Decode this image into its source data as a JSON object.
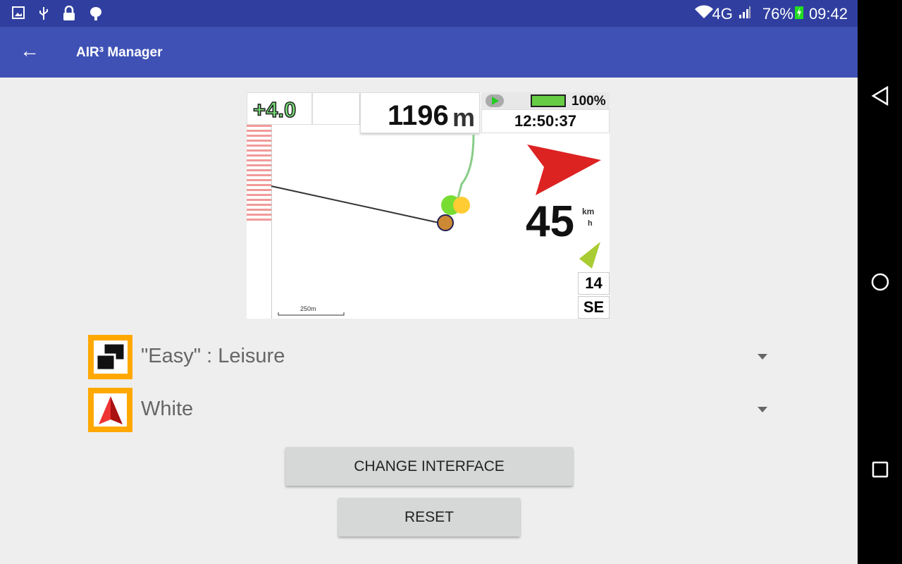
{
  "status_bar": {
    "network": "4G",
    "battery": "76%",
    "time": "09:42",
    "icons": [
      "image-icon",
      "usb-icon",
      "lock-icon",
      "android-icon",
      "wifi-icon",
      "signal-icon",
      "battery-charging-icon"
    ]
  },
  "app_bar": {
    "title": "AIR³ Manager",
    "back_icon": "arrow-left-icon"
  },
  "preview": {
    "vario": "+4.0",
    "altitude": "1196",
    "altitude_unit": "m",
    "battery": "100%",
    "clock": "12:50:37",
    "speed": "45",
    "speed_unit_top": "km",
    "speed_unit_bottom": "h",
    "wind_speed": "14",
    "wind_dir": "SE",
    "scale": "250m"
  },
  "spinners": [
    {
      "label": "\"Easy\" : Leisure",
      "icon": "layout-icon"
    },
    {
      "label": "White",
      "icon": "compass-arrow-icon"
    }
  ],
  "buttons": {
    "change": "CHANGE INTERFACE",
    "reset": "RESET"
  },
  "colors": {
    "status_bar": "#303F9F",
    "app_bar": "#3F51B5",
    "icon_bg": "#FFA800"
  }
}
